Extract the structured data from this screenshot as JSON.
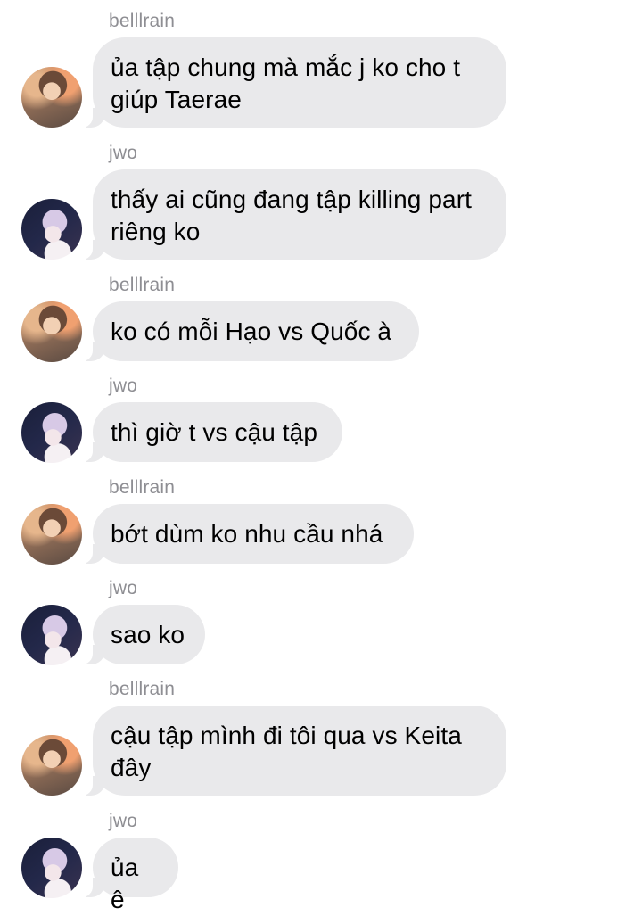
{
  "messages": [
    {
      "sender": "belllrain",
      "avatar": "avatar-belllrain",
      "text": "ủa tập chung mà mắc j ko cho t giúp Taerae"
    },
    {
      "sender": "jwo",
      "avatar": "avatar-jwo",
      "text": "thấy ai cũng đang tập killing part riêng ko"
    },
    {
      "sender": "belllrain",
      "avatar": "avatar-belllrain",
      "text": "ko có mỗi Hạo vs Quốc à"
    },
    {
      "sender": "jwo",
      "avatar": "avatar-jwo",
      "text": "thì giờ t vs cậu tập"
    },
    {
      "sender": "belllrain",
      "avatar": "avatar-belllrain",
      "text": "bớt dùm ko nhu cầu nhá"
    },
    {
      "sender": "jwo",
      "avatar": "avatar-jwo",
      "text": "sao ko"
    },
    {
      "sender": "belllrain",
      "avatar": "avatar-belllrain",
      "text": "cậu tập mình đi tôi qua vs Keita đây"
    },
    {
      "sender": "jwo",
      "avatar": "avatar-jwo",
      "text": "ủa ê"
    }
  ]
}
